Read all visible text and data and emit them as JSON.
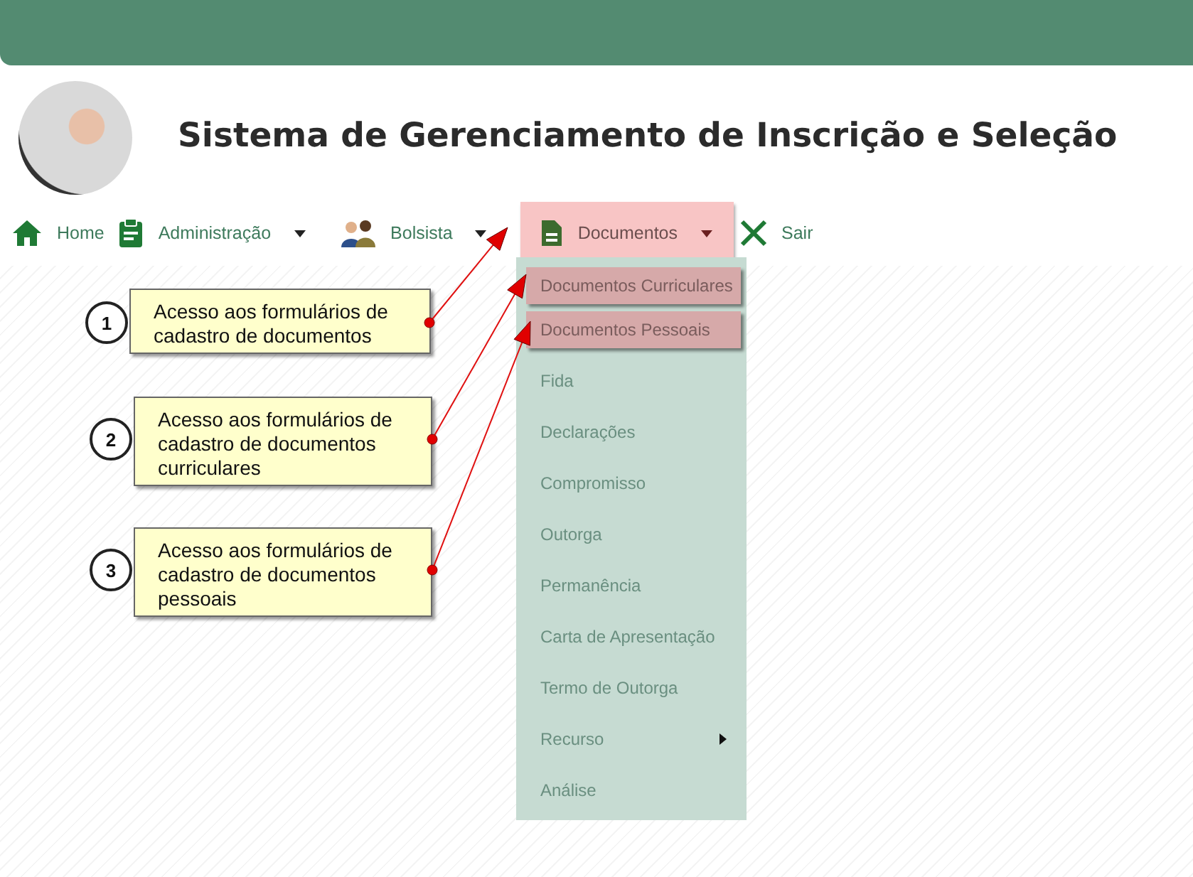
{
  "header": {
    "title": "Sistema de Gerenciamento de Inscrição e Seleção"
  },
  "nav": [
    {
      "label": "Home",
      "kind": "home",
      "dropdown": false,
      "selected": false
    },
    {
      "label": "Administração",
      "kind": "clipboard",
      "dropdown": true,
      "selected": false
    },
    {
      "label": "Bolsista",
      "kind": "people",
      "dropdown": true,
      "selected": false
    },
    {
      "label": "Documentos",
      "kind": "document",
      "dropdown": true,
      "selected": true
    },
    {
      "label": "Sair",
      "kind": "close",
      "dropdown": false,
      "selected": false
    }
  ],
  "menu": [
    {
      "label": "Documentos Curriculares",
      "highlighted": true,
      "submenu": false
    },
    {
      "label": "Documentos Pessoais",
      "highlighted": true,
      "submenu": false
    },
    {
      "label": "Fida",
      "highlighted": false,
      "submenu": false
    },
    {
      "label": "Declarações",
      "highlighted": false,
      "submenu": false
    },
    {
      "label": "Compromisso",
      "highlighted": false,
      "submenu": false
    },
    {
      "label": "Outorga",
      "highlighted": false,
      "submenu": false
    },
    {
      "label": "Permanência",
      "highlighted": false,
      "submenu": false
    },
    {
      "label": "Carta de Apresentação",
      "highlighted": false,
      "submenu": false
    },
    {
      "label": "Termo de Outorga",
      "highlighted": false,
      "submenu": false
    },
    {
      "label": "Recurso",
      "highlighted": false,
      "submenu": true
    },
    {
      "label": "Análise",
      "highlighted": false,
      "submenu": false
    }
  ],
  "callouts": [
    {
      "number": "1",
      "text": "Acesso aos formulários de cadastro de documentos"
    },
    {
      "number": "2",
      "text": "Acesso aos formulários de cadastro de documentos curriculares"
    },
    {
      "number": "3",
      "text": "Acesso aos formulários de cadastro de documentos pessoais"
    }
  ]
}
